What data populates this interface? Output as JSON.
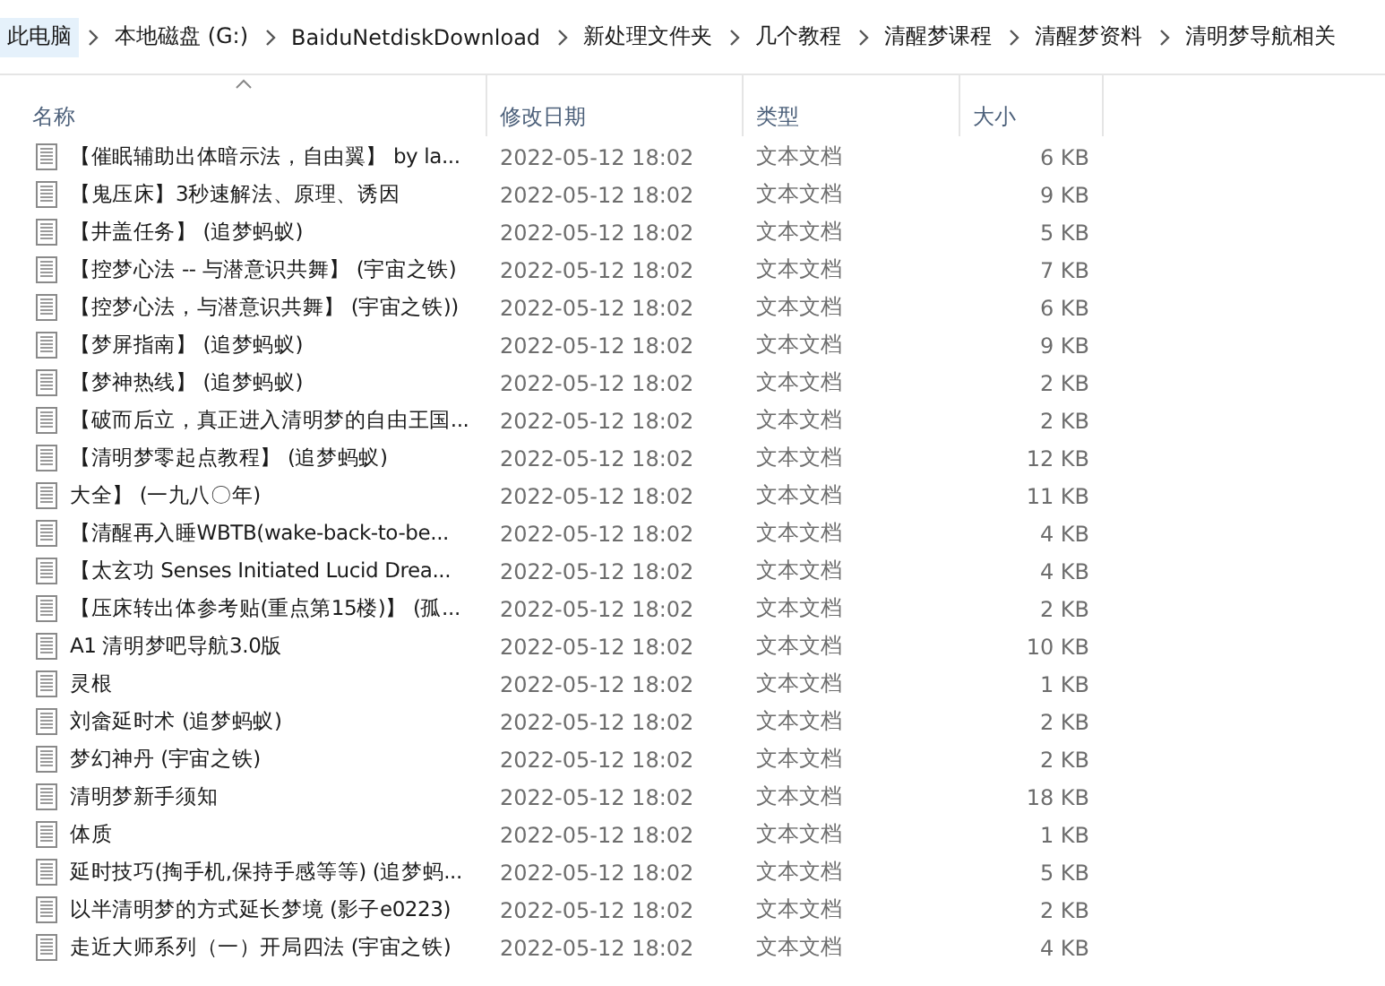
{
  "breadcrumb": [
    {
      "label": "此电脑",
      "selected": true
    },
    {
      "label": "本地磁盘 (G:)",
      "selected": false
    },
    {
      "label": "BaiduNetdiskDownload",
      "selected": false
    },
    {
      "label": "新处理文件夹",
      "selected": false
    },
    {
      "label": "几个教程",
      "selected": false
    },
    {
      "label": "清醒梦课程",
      "selected": false
    },
    {
      "label": "清醒梦资料",
      "selected": false
    },
    {
      "label": "清明梦导航相关",
      "selected": false
    }
  ],
  "table": {
    "columns": [
      {
        "label": "名称",
        "sorted": true
      },
      {
        "label": "修改日期",
        "sorted": false
      },
      {
        "label": "类型",
        "sorted": false
      },
      {
        "label": "大小",
        "sorted": false
      }
    ],
    "rows": [
      {
        "name": "【催眠辅助出体暗示法，自由翼】 by la...",
        "modified": "2022-05-12 18:02",
        "type": "文本文档",
        "size": "6 KB"
      },
      {
        "name": "【鬼压床】3秒速解法、原理、诱因",
        "modified": "2022-05-12 18:02",
        "type": "文本文档",
        "size": "9 KB"
      },
      {
        "name": "【井盖任务】 (追梦蚂蚁)",
        "modified": "2022-05-12 18:02",
        "type": "文本文档",
        "size": "5 KB"
      },
      {
        "name": "【控梦心法 -- 与潜意识共舞】 (宇宙之铁)",
        "modified": "2022-05-12 18:02",
        "type": "文本文档",
        "size": "7 KB"
      },
      {
        "name": "【控梦心法，与潜意识共舞】 (宇宙之铁))",
        "modified": "2022-05-12 18:02",
        "type": "文本文档",
        "size": "6 KB"
      },
      {
        "name": "【梦屏指南】  (追梦蚂蚁)",
        "modified": "2022-05-12 18:02",
        "type": "文本文档",
        "size": "9 KB"
      },
      {
        "name": "【梦神热线】 (追梦蚂蚁)",
        "modified": "2022-05-12 18:02",
        "type": "文本文档",
        "size": "2 KB"
      },
      {
        "name": "【破而后立，真正进入清明梦的自由王国...",
        "modified": "2022-05-12 18:02",
        "type": "文本文档",
        "size": "2 KB"
      },
      {
        "name": "【清明梦零起点教程】  (追梦蚂蚁)",
        "modified": "2022-05-12 18:02",
        "type": "文本文档",
        "size": "12 KB"
      },
      {
        "name": "大全】 (一九八〇年)",
        "modified": "2022-05-12 18:02",
        "type": "文本文档",
        "size": "11 KB"
      },
      {
        "name": "【清醒再入睡WBTB(wake-back-to-be...",
        "modified": "2022-05-12 18:02",
        "type": "文本文档",
        "size": "4 KB"
      },
      {
        "name": "【太玄功 Senses Initiated Lucid Drea...",
        "modified": "2022-05-12 18:02",
        "type": "文本文档",
        "size": "4 KB"
      },
      {
        "name": "【压床转出体参考贴(重点第15楼)】 (孤...",
        "modified": "2022-05-12 18:02",
        "type": "文本文档",
        "size": "2 KB"
      },
      {
        "name": "A1 清明梦吧导航3.0版",
        "modified": "2022-05-12 18:02",
        "type": "文本文档",
        "size": "10 KB"
      },
      {
        "name": "灵根",
        "modified": "2022-05-12 18:02",
        "type": "文本文档",
        "size": "1 KB"
      },
      {
        "name": "刘畲延时术 (追梦蚂蚁)",
        "modified": "2022-05-12 18:02",
        "type": "文本文档",
        "size": "2 KB"
      },
      {
        "name": "梦幻神丹 (宇宙之铁)",
        "modified": "2022-05-12 18:02",
        "type": "文本文档",
        "size": "2 KB"
      },
      {
        "name": "清明梦新手须知",
        "modified": "2022-05-12 18:02",
        "type": "文本文档",
        "size": "18 KB"
      },
      {
        "name": "体质",
        "modified": "2022-05-12 18:02",
        "type": "文本文档",
        "size": "1 KB"
      },
      {
        "name": "延时技巧(掏手机,保持手感等等) (追梦蚂...",
        "modified": "2022-05-12 18:02",
        "type": "文本文档",
        "size": "5 KB"
      },
      {
        "name": "以半清明梦的方式延长梦境 (影子e0223)",
        "modified": "2022-05-12 18:02",
        "type": "文本文档",
        "size": "2 KB"
      },
      {
        "name": "走近大师系列（一）开局四法 (宇宙之铁)",
        "modified": "2022-05-12 18:02",
        "type": "文本文档",
        "size": "4 KB"
      }
    ]
  }
}
